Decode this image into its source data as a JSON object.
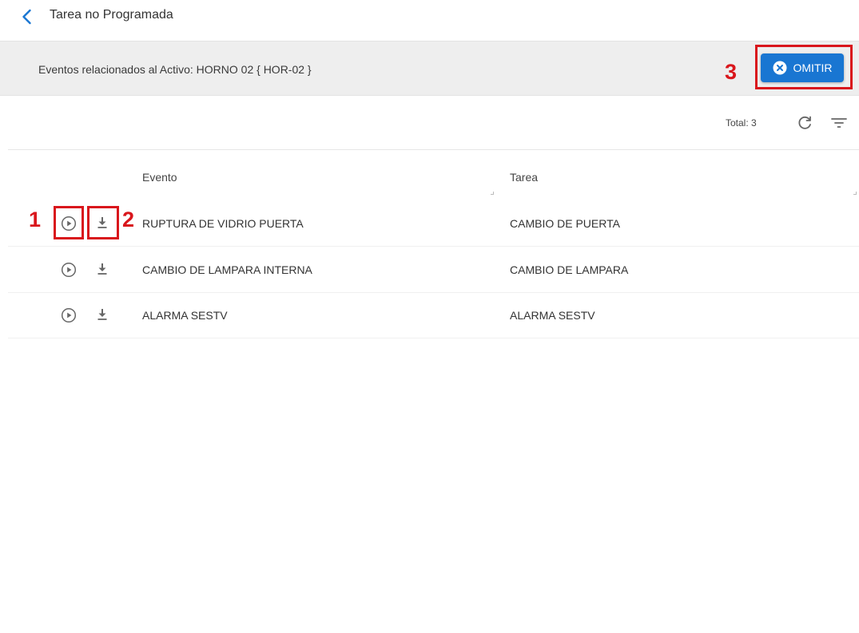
{
  "page": {
    "title": "Tarea no Programada"
  },
  "header": {
    "text": "Eventos relacionados al Activo: HORNO 02 { HOR-02 }",
    "omit_button_label": "OMITIR"
  },
  "toolbar": {
    "total_label": "Total: 3"
  },
  "table": {
    "columns": [
      "Evento",
      "Tarea"
    ],
    "rows": [
      {
        "evento": "RUPTURA DE VIDRIO PUERTA",
        "tarea": "CAMBIO DE PUERTA"
      },
      {
        "evento": "CAMBIO DE LAMPARA INTERNA",
        "tarea": "CAMBIO DE LAMPARA"
      },
      {
        "evento": "ALARMA SESTV",
        "tarea": "ALARMA SESTV"
      }
    ]
  },
  "annotations": {
    "n1": "1",
    "n2": "2",
    "n3": "3"
  },
  "colors": {
    "accent": "#1976d2",
    "annotation": "#d9161c",
    "header_band": "#eeeeee"
  },
  "icons": [
    "chevron-left-icon",
    "close-circle-icon",
    "refresh-icon",
    "filter-icon",
    "play-circle-icon",
    "download-icon"
  ]
}
